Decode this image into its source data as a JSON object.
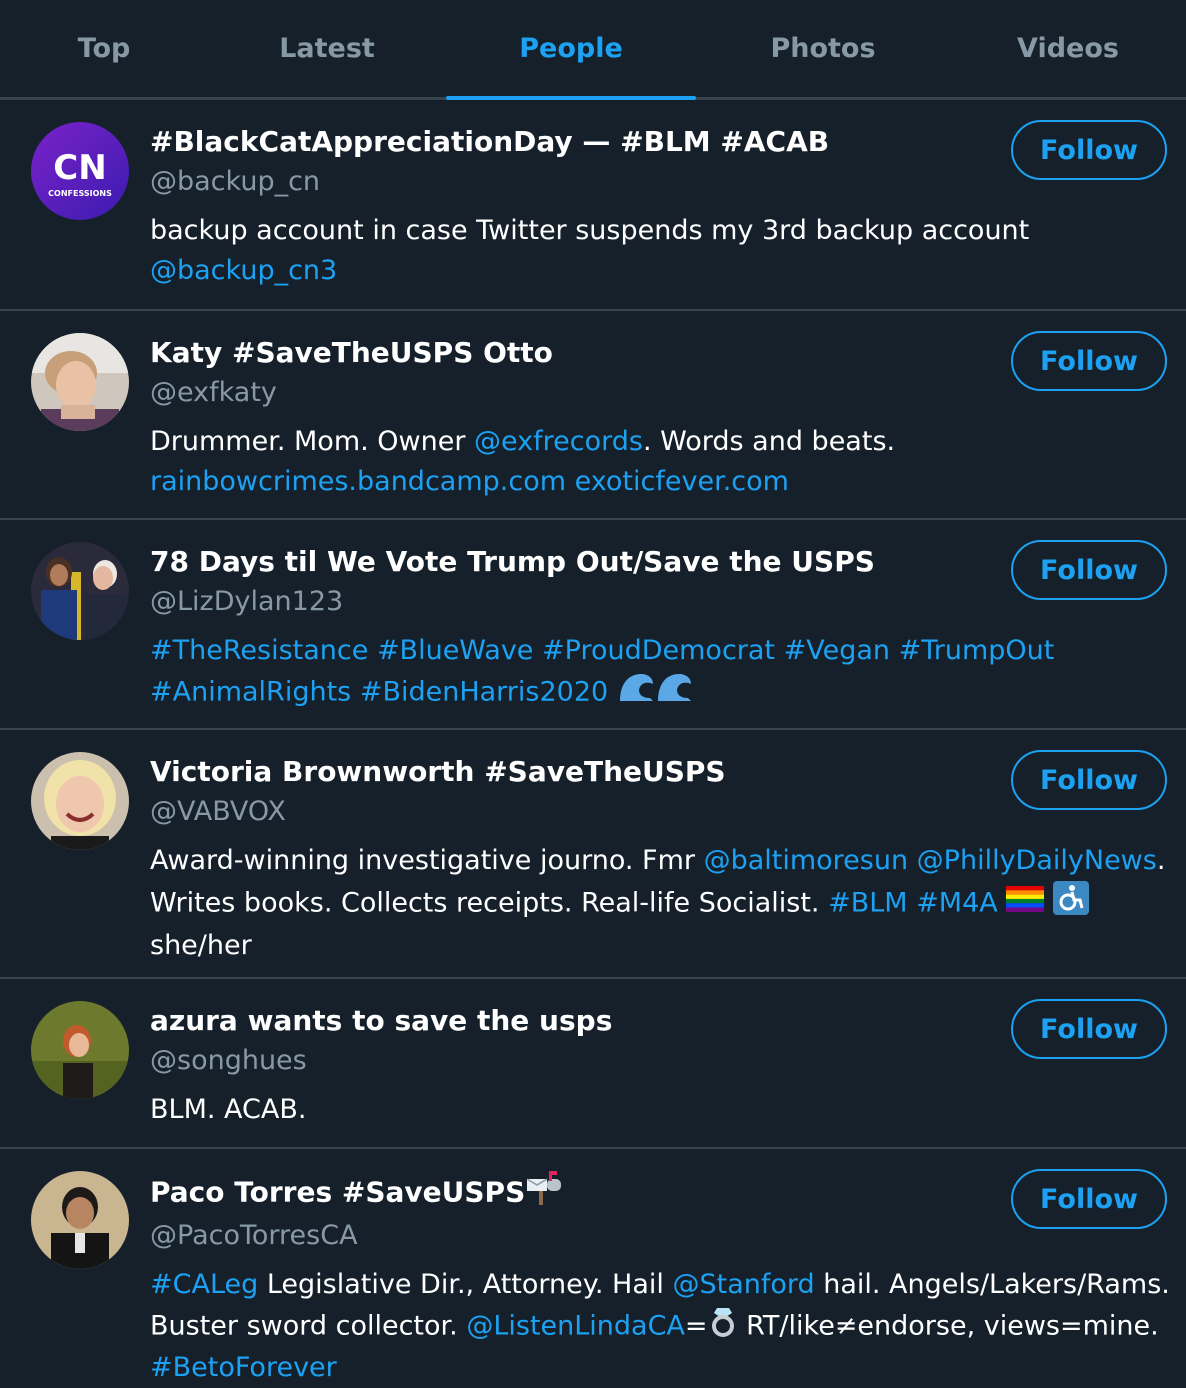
{
  "tabs": [
    "Top",
    "Latest",
    "People",
    "Photos",
    "Videos"
  ],
  "active_tab": "People",
  "avatar_text": {
    "logo": "CN",
    "sub": "CONFESSIONS"
  },
  "follow_label": "Follow",
  "users": [
    {
      "name": "#BlackCatAppreciationDay — #BLM #ACAB",
      "handle": "@backup_cn",
      "bio": {
        "l1_a": "backup account in case Twitter suspends my 3rd backup account",
        "l2_a": "@backup_cn3"
      }
    },
    {
      "name": "Katy #SaveTheUSPS Otto",
      "handle": "@exfkaty",
      "bio": {
        "l1_a": "Drummer. Mom. Owner ",
        "l1_b": "@exfrecords",
        "l1_c": ". Words and beats.",
        "l2_a": "rainbowcrimes.bandcamp.com",
        "l2_b": "exoticfever.com"
      }
    },
    {
      "name": "78 Days til We Vote Trump Out/Save the USPS",
      "handle": "@LizDylan123",
      "bio": {
        "l1_a": "#TheResistance",
        "l1_b": "#BlueWave",
        "l1_c": "#ProudDemocrat",
        "l1_d": "#Vegan",
        "l1_e": "#TrumpOut",
        "l2_a": "#AnimalRights",
        "l2_b": "#BidenHarris2020",
        "l2_emoji": "wave-emoji"
      }
    },
    {
      "name": "Victoria Brownworth #SaveTheUSPS",
      "handle": "@VABVOX",
      "bio": {
        "l1_a": "Award-winning investigative journo. Fmr ",
        "l1_b": "@baltimoresun",
        "l1_c": "@PhillyDailyNews",
        "l1_d": ".",
        "l2_a": "Writes books. Collects receipts. Real-life Socialist. ",
        "l2_b": "#BLM",
        "l2_c": "#M4A",
        "l3_a": "she/her"
      }
    },
    {
      "name": "azura wants to save the usps",
      "handle": "@songhues",
      "bio": {
        "l1_a": "BLM. ACAB."
      }
    },
    {
      "name": "Paco Torres #SaveUSPS",
      "handle": "@PacoTorresCA",
      "bio": {
        "l1_a": "#CALeg",
        "l1_b": " Legislative Dir., Attorney. Hail ",
        "l1_c": "@Stanford",
        "l1_d": " hail. Angels/Lakers/Rams.",
        "l2_a": "Buster sword collector. ",
        "l2_b": "@ListenLindaCA",
        "l2_c": "=",
        "l2_d": " RT/like≠endorse, views=mine.",
        "l3_a": "#BetoForever"
      }
    }
  ],
  "colors": {
    "background": "#15202b",
    "accent": "#1da1f2",
    "muted": "#8899a6",
    "divider": "#38444d"
  }
}
